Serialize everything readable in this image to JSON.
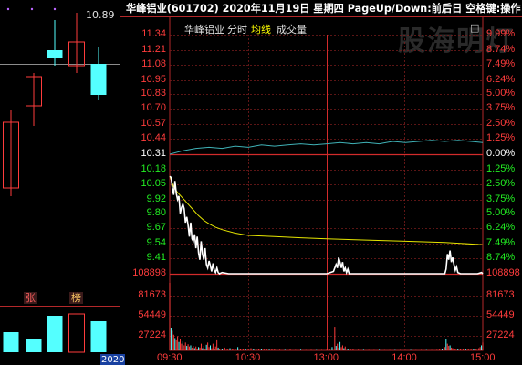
{
  "colors": {
    "red": "#d22b2b",
    "axis_red": "#b4282a",
    "up": "#ff3c3c",
    "down": "#54ffff",
    "flat": "#ffffff",
    "white_line": "#ffffff",
    "avg_line": "#e6e600",
    "index_line": "#3fb1b6",
    "grid": "#7a1c1c",
    "header_text": "#ffffff",
    "title_gold": "#ffd34d",
    "marker_yellow": "#ffff00"
  },
  "header": {
    "text": "华峰铝业(601702)  2020年11月19日 星期四 PageUp/Down:前后日 空格键:操作"
  },
  "left_panel": {
    "max_price_label": "10.89",
    "dots": [
      "•",
      "•",
      "•"
    ],
    "zhang_label": "张",
    "bang_label": "榜",
    "date_label": "2020"
  },
  "chart_header": {
    "name": "华峰铝业",
    "mode": "分时",
    "avg_label": "均线",
    "vol_label": "成交量",
    "corner_box": "□"
  },
  "watermark": "股海明灯",
  "left_price_labels": [
    "11.34",
    "11.21",
    "11.08",
    "10.95",
    "10.83",
    "10.70",
    "10.57",
    "10.44",
    "10.31",
    "10.18",
    "10.05",
    "9.92",
    "9.80",
    "9.67",
    "9.54",
    "9.41",
    "108898",
    "81673",
    "54449",
    "27224"
  ],
  "right_pct_labels": [
    "9.99%",
    "8.74%",
    "7.49%",
    "6.24%",
    "5.00%",
    "3.75%",
    "2.50%",
    "1.25%",
    "0.00%",
    "1.25%",
    "2.50%",
    "3.75%",
    "5.00%",
    "6.24%",
    "7.49%",
    "8.74%",
    "108898",
    "81673",
    "54449",
    "27224"
  ],
  "time_labels": [
    "09:30",
    "10:30",
    "13:00",
    "14:00",
    "15:00"
  ],
  "chart_data": {
    "type": "line",
    "x_ticks": [
      "09:30",
      "10:30",
      "13:00",
      "14:00",
      "15:00"
    ],
    "y_price_range": [
      9.28,
      11.34
    ],
    "prev_close": 10.31,
    "volume_range": [
      0,
      136122
    ],
    "price_series": [
      [
        0,
        10.12
      ],
      [
        1,
        10.11
      ],
      [
        2,
        10.02
      ],
      [
        3,
        9.96
      ],
      [
        4,
        10.08
      ],
      [
        5,
        9.97
      ],
      [
        6,
        9.92
      ],
      [
        7,
        9.95
      ],
      [
        8,
        9.8
      ],
      [
        9,
        9.85
      ],
      [
        10,
        9.88
      ],
      [
        11,
        9.84
      ],
      [
        12,
        9.72
      ],
      [
        13,
        9.77
      ],
      [
        14,
        9.7
      ],
      [
        15,
        9.6
      ],
      [
        16,
        9.72
      ],
      [
        17,
        9.58
      ],
      [
        18,
        9.56
      ],
      [
        19,
        9.62
      ],
      [
        20,
        9.5
      ],
      [
        21,
        9.6
      ],
      [
        22,
        9.46
      ],
      [
        23,
        9.4
      ],
      [
        24,
        9.56
      ],
      [
        25,
        9.45
      ],
      [
        26,
        9.4
      ],
      [
        27,
        9.5
      ],
      [
        28,
        9.36
      ],
      [
        29,
        9.33
      ],
      [
        30,
        9.39
      ],
      [
        31,
        9.35
      ],
      [
        32,
        9.3
      ],
      [
        33,
        9.37
      ],
      [
        34,
        9.31
      ],
      [
        35,
        9.29
      ],
      [
        36,
        9.33
      ],
      [
        37,
        9.29
      ],
      [
        38,
        9.28
      ],
      [
        40,
        9.29
      ],
      [
        45,
        9.28
      ],
      [
        60,
        9.28
      ],
      [
        80,
        9.28
      ],
      [
        100,
        9.28
      ],
      [
        120,
        9.28
      ],
      [
        125,
        9.3
      ],
      [
        127,
        9.36
      ],
      [
        128,
        9.33
      ],
      [
        129,
        9.42
      ],
      [
        130,
        9.38
      ],
      [
        131,
        9.33
      ],
      [
        132,
        9.38
      ],
      [
        133,
        9.3
      ],
      [
        134,
        9.33
      ],
      [
        135,
        9.29
      ],
      [
        136,
        9.32
      ],
      [
        137,
        9.28
      ],
      [
        140,
        9.28
      ],
      [
        160,
        9.28
      ],
      [
        180,
        9.28
      ],
      [
        200,
        9.28
      ],
      [
        210,
        9.28
      ],
      [
        211,
        9.32
      ],
      [
        212,
        9.45
      ],
      [
        213,
        9.4
      ],
      [
        214,
        9.48
      ],
      [
        215,
        9.38
      ],
      [
        216,
        9.42
      ],
      [
        217,
        9.36
      ],
      [
        218,
        9.31
      ],
      [
        219,
        9.34
      ],
      [
        220,
        9.29
      ],
      [
        222,
        9.28
      ],
      [
        235,
        9.28
      ],
      [
        238,
        9.29
      ],
      [
        239,
        9.28
      ]
    ],
    "avg_series": [
      [
        0,
        10.12
      ],
      [
        3,
        10.03
      ],
      [
        6,
        9.98
      ],
      [
        10,
        9.93
      ],
      [
        14,
        9.88
      ],
      [
        18,
        9.83
      ],
      [
        22,
        9.78
      ],
      [
        26,
        9.74
      ],
      [
        30,
        9.71
      ],
      [
        35,
        9.68
      ],
      [
        40,
        9.66
      ],
      [
        50,
        9.63
      ],
      [
        60,
        9.61
      ],
      [
        80,
        9.6
      ],
      [
        100,
        9.59
      ],
      [
        120,
        9.58
      ],
      [
        150,
        9.57
      ],
      [
        180,
        9.56
      ],
      [
        210,
        9.55
      ],
      [
        239,
        9.53
      ]
    ],
    "index_series": [
      [
        0,
        10.31
      ],
      [
        10,
        10.34
      ],
      [
        20,
        10.36
      ],
      [
        30,
        10.37
      ],
      [
        40,
        10.36
      ],
      [
        50,
        10.38
      ],
      [
        60,
        10.37
      ],
      [
        70,
        10.39
      ],
      [
        80,
        10.38
      ],
      [
        90,
        10.39
      ],
      [
        100,
        10.4
      ],
      [
        110,
        10.39
      ],
      [
        120,
        10.4
      ],
      [
        130,
        10.41
      ],
      [
        140,
        10.4
      ],
      [
        150,
        10.41
      ],
      [
        160,
        10.4
      ],
      [
        170,
        10.42
      ],
      [
        180,
        10.41
      ],
      [
        190,
        10.42
      ],
      [
        200,
        10.43
      ],
      [
        210,
        10.42
      ],
      [
        220,
        10.43
      ],
      [
        230,
        10.42
      ],
      [
        239,
        10.41
      ]
    ],
    "volumes": [
      [
        0,
        120000
      ],
      [
        1,
        40000
      ],
      [
        2,
        35000
      ],
      [
        3,
        28000
      ],
      [
        4,
        22000
      ],
      [
        5,
        18000
      ],
      [
        6,
        25000
      ],
      [
        7,
        15000
      ],
      [
        8,
        20000
      ],
      [
        9,
        12000
      ],
      [
        10,
        16000
      ],
      [
        11,
        9000
      ],
      [
        12,
        14000
      ],
      [
        13,
        8000
      ],
      [
        14,
        11000
      ],
      [
        15,
        7000
      ],
      [
        16,
        9000
      ],
      [
        17,
        5000
      ],
      [
        18,
        8000
      ],
      [
        19,
        4000
      ],
      [
        20,
        7000
      ],
      [
        21,
        3000
      ],
      [
        22,
        6000
      ],
      [
        23,
        5000
      ],
      [
        24,
        12000
      ],
      [
        25,
        4000
      ],
      [
        26,
        8000
      ],
      [
        27,
        3000
      ],
      [
        28,
        10000
      ],
      [
        29,
        14000
      ],
      [
        30,
        6000
      ],
      [
        31,
        9000
      ],
      [
        32,
        4000
      ],
      [
        33,
        12000
      ],
      [
        34,
        3000
      ],
      [
        35,
        7000
      ],
      [
        36,
        18000
      ],
      [
        37,
        5000
      ],
      [
        38,
        2000
      ],
      [
        40,
        3000
      ],
      [
        42,
        5000
      ],
      [
        44,
        2000
      ],
      [
        46,
        4000
      ],
      [
        48,
        2500
      ],
      [
        50,
        3000
      ],
      [
        52,
        6000
      ],
      [
        54,
        2000
      ],
      [
        56,
        3000
      ],
      [
        58,
        1500
      ],
      [
        60,
        2500
      ],
      [
        62,
        4000
      ],
      [
        64,
        2000
      ],
      [
        66,
        3000
      ],
      [
        68,
        1800
      ],
      [
        70,
        2200
      ],
      [
        72,
        1500
      ],
      [
        74,
        2000
      ],
      [
        76,
        1200
      ],
      [
        78,
        1800
      ],
      [
        80,
        1500
      ],
      [
        84,
        1200
      ],
      [
        88,
        1000
      ],
      [
        92,
        1400
      ],
      [
        96,
        900
      ],
      [
        100,
        1200
      ],
      [
        104,
        800
      ],
      [
        108,
        1000
      ],
      [
        112,
        700
      ],
      [
        116,
        900
      ],
      [
        120,
        1200
      ],
      [
        122,
        3000
      ],
      [
        124,
        6000
      ],
      [
        126,
        42000
      ],
      [
        127,
        8000
      ],
      [
        128,
        12000
      ],
      [
        129,
        5000
      ],
      [
        130,
        15000
      ],
      [
        131,
        6000
      ],
      [
        132,
        9000
      ],
      [
        133,
        4000
      ],
      [
        134,
        7000
      ],
      [
        136,
        3000
      ],
      [
        138,
        2000
      ],
      [
        140,
        1500
      ],
      [
        144,
        1200
      ],
      [
        148,
        1000
      ],
      [
        152,
        900
      ],
      [
        156,
        800
      ],
      [
        160,
        1000
      ],
      [
        164,
        700
      ],
      [
        168,
        800
      ],
      [
        172,
        700
      ],
      [
        176,
        900
      ],
      [
        180,
        700
      ],
      [
        184,
        800
      ],
      [
        188,
        600
      ],
      [
        192,
        900
      ],
      [
        196,
        700
      ],
      [
        200,
        800
      ],
      [
        204,
        1000
      ],
      [
        206,
        1500
      ],
      [
        208,
        3000
      ],
      [
        210,
        6000
      ],
      [
        211,
        20000
      ],
      [
        212,
        12000
      ],
      [
        213,
        8000
      ],
      [
        214,
        9000
      ],
      [
        215,
        5000
      ],
      [
        216,
        4000
      ],
      [
        218,
        3000
      ],
      [
        220,
        2500
      ],
      [
        222,
        2000
      ],
      [
        224,
        1500
      ],
      [
        226,
        1800
      ],
      [
        228,
        2500
      ],
      [
        230,
        1500
      ],
      [
        232,
        2000
      ],
      [
        234,
        3000
      ],
      [
        236,
        4000
      ],
      [
        237,
        6000
      ],
      [
        238,
        9000
      ],
      [
        239,
        14000
      ]
    ]
  }
}
